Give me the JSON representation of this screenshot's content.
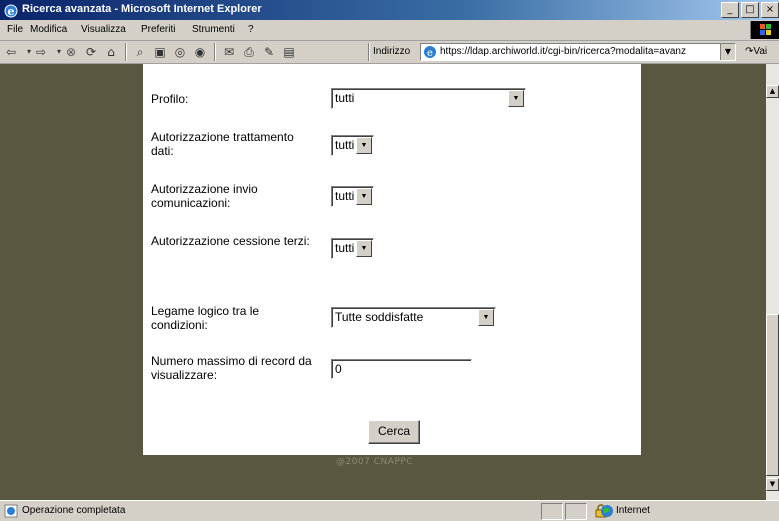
{
  "window": {
    "title": "Ricerca avanzata - Microsoft Internet Explorer",
    "buttons": [
      "_",
      "□",
      "×"
    ]
  },
  "menu": [
    {
      "label": "File",
      "key": "F"
    },
    {
      "label": "Modifica",
      "key": "M"
    },
    {
      "label": "Visualizza",
      "key": "V"
    },
    {
      "label": "Preferiti",
      "key": "P"
    },
    {
      "label": "Strumenti",
      "key": "S"
    },
    {
      "label": "?",
      "key": "?"
    }
  ],
  "toolbar": {
    "address_label": "Indirizzo",
    "url": "https://ldap.archiworld.it/cgi-bin/ricerca?modalita=avanz",
    "go_label": "Vai",
    "icons": [
      "back-icon",
      "forward-icon",
      "stop-icon",
      "refresh-icon",
      "home-icon",
      "search-icon",
      "favorites-icon",
      "history-icon",
      "mail-icon",
      "print-icon",
      "edit-icon",
      "discuss-icon"
    ]
  },
  "form": {
    "profilo": {
      "label": "Profilo:",
      "value": "tutti"
    },
    "trattamento": {
      "label": "Autorizzazione trattamento dati:",
      "value": "tutti"
    },
    "invio": {
      "label": "Autorizzazione invio comunicazioni:",
      "value": "tutti"
    },
    "cessione": {
      "label": "Autorizzazione cessione terzi:",
      "value": "tutti"
    },
    "legame": {
      "label": "Legame logico tra le condizioni:",
      "value": "Tutte soddisfatte"
    },
    "numero": {
      "label": "Numero massimo di record da visualizzare:",
      "value": "0"
    },
    "submit_label": "Cerca"
  },
  "footer": {
    "copyright": "@2007 CNAPPC"
  },
  "status": {
    "text": "Operazione completata",
    "zone": "Internet"
  },
  "colors": {
    "page_bg": "#59573f",
    "content_bg": "#ffffff",
    "titlebar": "#0a246a"
  }
}
